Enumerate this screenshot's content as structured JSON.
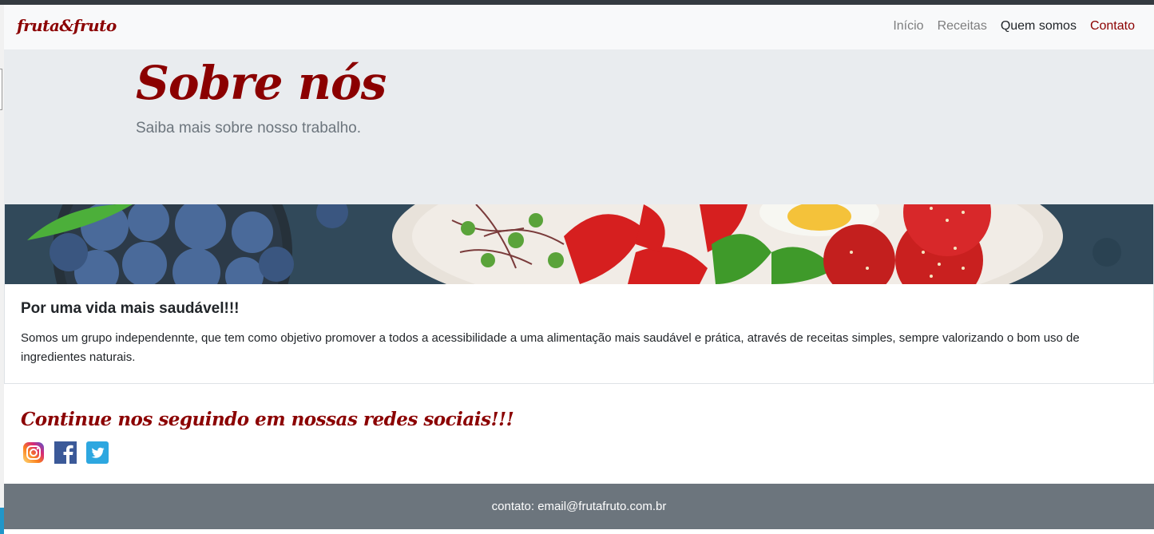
{
  "nav": {
    "brand": "fruta&fruto",
    "links": [
      {
        "label": "Início"
      },
      {
        "label": "Receitas"
      },
      {
        "label": "Quem somos"
      },
      {
        "label": "Contato"
      }
    ]
  },
  "hero": {
    "title": "Sobre nós",
    "subtitle": "Saiba mais sobre nosso trabalho."
  },
  "card": {
    "title": "Por uma vida mais saudável!!!",
    "text": "Somos um grupo independennte, que tem como objetivo promover a todos a acessibilidade a uma alimentação mais saudável e prática, através de receitas simples, sempre valorizando o bom uso de ingredientes naturais."
  },
  "social": {
    "heading": "Continue nos seguindo em nossas redes sociais!!!",
    "icons": [
      "instagram-icon",
      "facebook-icon",
      "twitter-icon"
    ]
  },
  "footer": {
    "text": "contato: email@frutafruto.com.br"
  },
  "colors": {
    "brand": "#8b0000",
    "navbar_bg": "#f8f9fa",
    "jumbotron_bg": "#e9ecef",
    "footer_bg": "#6c757d"
  }
}
